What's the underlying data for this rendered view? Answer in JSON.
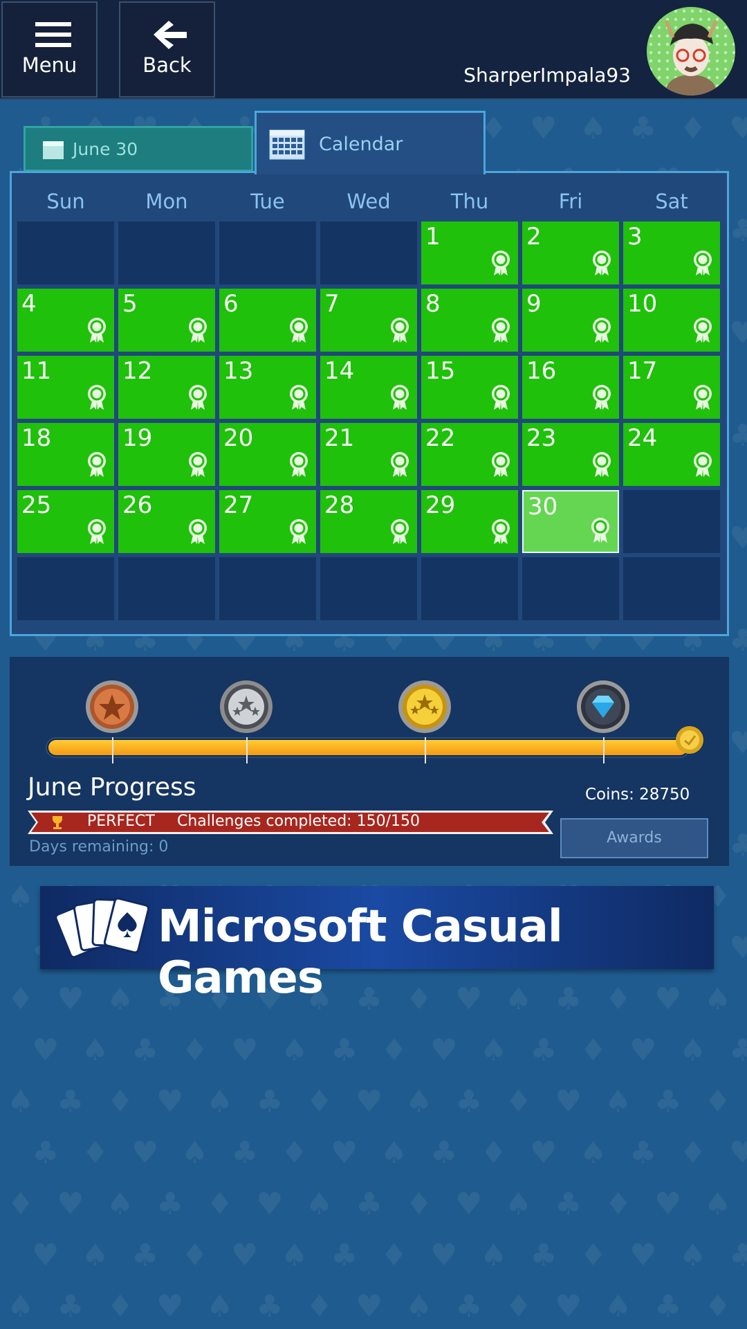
{
  "topbar": {
    "menu_label": "Menu",
    "back_label": "Back",
    "username": "SharperImpala93"
  },
  "tabs": {
    "date_label": "June 30",
    "calendar_label": "Calendar"
  },
  "calendar": {
    "days_of_week": [
      "Sun",
      "Mon",
      "Tue",
      "Wed",
      "Thu",
      "Fri",
      "Sat"
    ],
    "first_weekday_index": 4,
    "days_in_month": 30,
    "completed_days": [
      1,
      2,
      3,
      4,
      5,
      6,
      7,
      8,
      9,
      10,
      11,
      12,
      13,
      14,
      15,
      16,
      17,
      18,
      19,
      20,
      21,
      22,
      23,
      24,
      25,
      26,
      27,
      28,
      29,
      30
    ],
    "selected_day": 30,
    "rows": 6
  },
  "progress": {
    "title": "June Progress",
    "status_badge": "PERFECT",
    "challenges_text": "Challenges completed: 150/150",
    "days_remaining": "Days remaining: 0",
    "coins": "Coins: 28750",
    "awards_label": "Awards",
    "fraction_complete": 1.0,
    "milestones": [
      "bronze-medal",
      "silver-medal",
      "gold-medal",
      "diamond-medal"
    ]
  },
  "ad_banner": {
    "text": "Microsoft Casual Games"
  },
  "colors": {
    "completed_day": "#1fc10a",
    "selected_day": "#65d651",
    "empty_day": "#143463",
    "progress_bar": "#f7a91c",
    "banner_red": "#a7271f"
  }
}
